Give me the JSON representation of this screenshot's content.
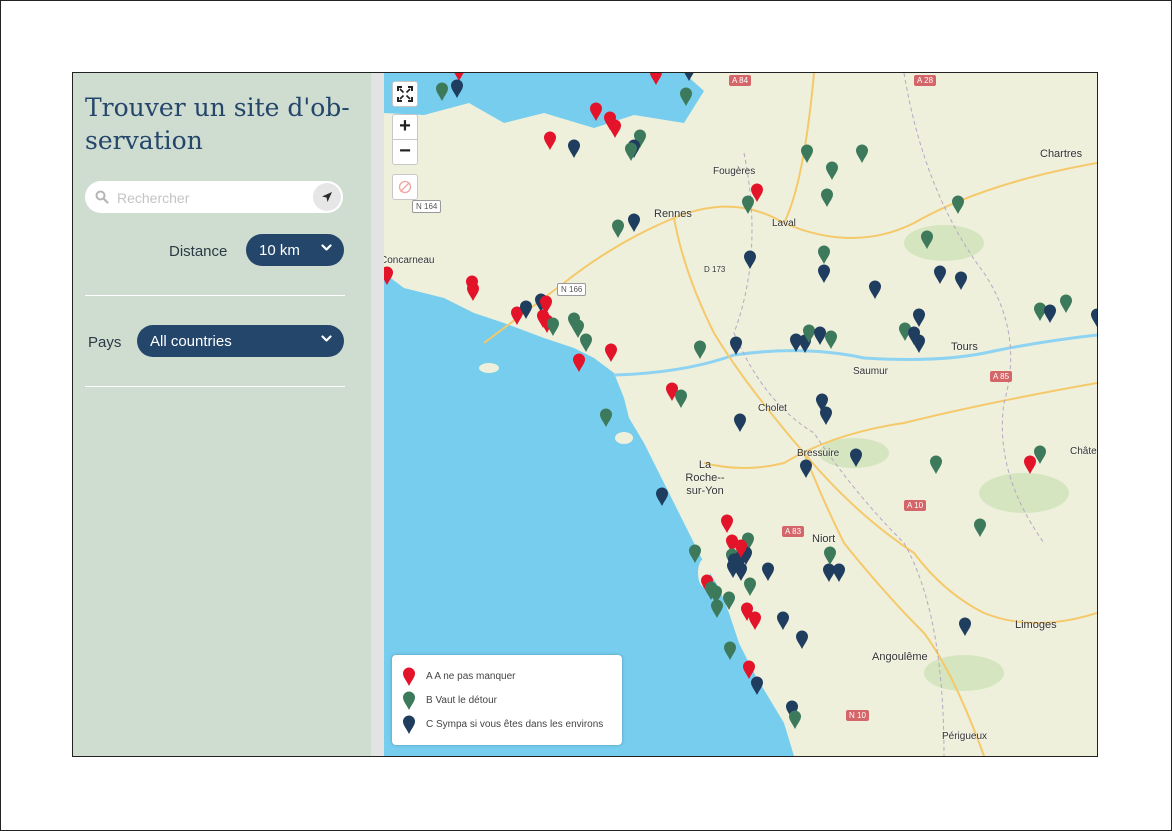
{
  "sidebar": {
    "title": "Trouver un site d'ob-servation",
    "search": {
      "placeholder": "Rechercher"
    },
    "distance": {
      "label": "Distance",
      "value": "10 km"
    },
    "pays": {
      "label": "Pays",
      "value": "All countries"
    }
  },
  "map": {
    "controls": {
      "zoom_in": "+",
      "zoom_out": "−"
    },
    "colors": {
      "A": "#e3132a",
      "B": "#3d7a5c",
      "C": "#1f3d5e",
      "sea": "#76cdee",
      "land": "#eef0dc"
    },
    "places": [
      {
        "name": "Fougères"
      },
      {
        "name": "Chartres"
      },
      {
        "name": "Rennes"
      },
      {
        "name": "Laval"
      },
      {
        "name": "Tours"
      },
      {
        "name": "Saumur"
      },
      {
        "name": "Cholet"
      },
      {
        "name": "Bressuire"
      },
      {
        "name": "La Roche-­sur-Yon"
      },
      {
        "name": "Niort"
      },
      {
        "name": "Angoulême"
      },
      {
        "name": "Limoges"
      },
      {
        "name": "Périgueux"
      },
      {
        "name": "Châteauroux"
      },
      {
        "name": "Concarneau"
      }
    ],
    "roads": [
      "A 84",
      "A 28",
      "N 164",
      "N 166",
      "D 173",
      "A 85",
      "A 10",
      "A 83",
      "N 10"
    ],
    "legend": [
      {
        "category": "A",
        "label": "A A ne pas manquer"
      },
      {
        "category": "B",
        "label": "B Vaut le détour"
      },
      {
        "category": "C",
        "label": "C Sympa si vous êtes dans les environs"
      }
    ]
  }
}
